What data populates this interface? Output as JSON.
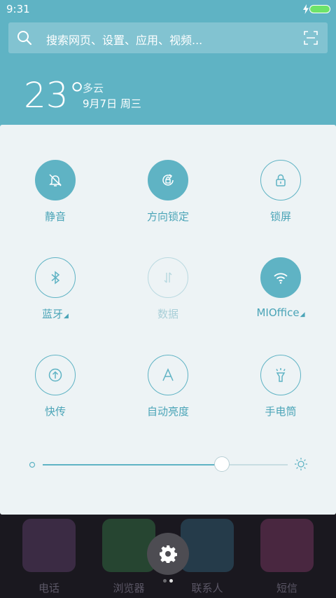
{
  "status": {
    "time": "9:31"
  },
  "search": {
    "placeholder": "搜索网页、设置、应用、视频..."
  },
  "weather": {
    "temperature": "23°",
    "condition": "多云",
    "date": "9月7日  周三"
  },
  "tiles": [
    {
      "label": "静音",
      "state": "on",
      "icon": "bell-off-icon"
    },
    {
      "label": "方向锁定",
      "state": "on",
      "icon": "rotation-lock-icon"
    },
    {
      "label": "锁屏",
      "state": "off",
      "icon": "padlock-icon"
    },
    {
      "label": "蓝牙",
      "state": "off",
      "icon": "bluetooth-icon",
      "expand": "◢"
    },
    {
      "label": "数据",
      "state": "disabled",
      "icon": "mobile-data-icon"
    },
    {
      "label": "MIOffice",
      "state": "on",
      "icon": "wifi-icon",
      "expand": "◢"
    },
    {
      "label": "快传",
      "state": "off",
      "icon": "transfer-icon"
    },
    {
      "label": "自动亮度",
      "state": "off",
      "icon": "auto-brightness-icon"
    },
    {
      "label": "手电筒",
      "state": "off",
      "icon": "flashlight-icon"
    }
  ],
  "brightness": {
    "level": 0.73
  },
  "dock": [
    {
      "label": "电话",
      "color": "#7a4f8a"
    },
    {
      "label": "浏览器",
      "color": "#3f9b54"
    },
    {
      "label": "联系人",
      "color": "#3b7f9b"
    },
    {
      "label": "短信",
      "color": "#a2447f"
    }
  ],
  "colors": {
    "accent": "#5fb3c4",
    "panel": "#edf3f5"
  }
}
